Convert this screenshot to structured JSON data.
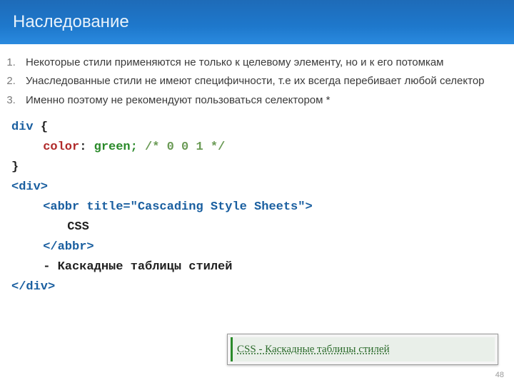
{
  "header": {
    "title": "Наследование"
  },
  "bullets": [
    "Некоторые стили применяются не только к целевому элементу, но и к его потомкам",
    "Унаследованные стили не имеют специфичности, т.е их всегда перебивает любой селектор",
    "Именно поэтому не рекомендуют пользоваться селектором *"
  ],
  "css_code": {
    "selector": "div",
    "open": "{",
    "prop": "color",
    "sep": ": ",
    "value_with_semi": "green;",
    "comment": "/* 0 0 1 */",
    "close": "}"
  },
  "html_code": {
    "open_div": "<div>",
    "open_abbr": "<abbr title=\"Cascading Style Sheets\">",
    "abbr_text": "CSS",
    "close_abbr": "</abbr>",
    "text_line": "- Каскадные таблицы стилей",
    "close_div": "</div>"
  },
  "render": {
    "text": "CSS - Каскадные таблицы стилей"
  },
  "page": {
    "num": "48"
  }
}
